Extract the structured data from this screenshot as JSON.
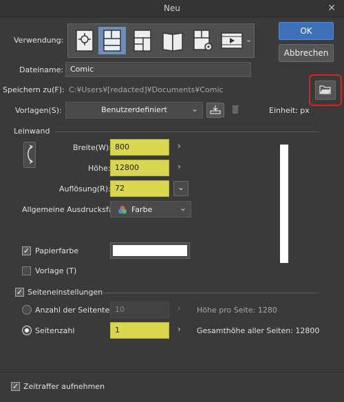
{
  "window": {
    "title": "Neu",
    "close": "✕"
  },
  "buttons": {
    "ok": "OK",
    "cancel": "Abbrechen"
  },
  "usage": {
    "label": "Verwendung:",
    "items": [
      "illustration-icon",
      "comic-icon",
      "layout-icon",
      "book-icon",
      "settings-page-icon",
      "animation-icon"
    ],
    "selected_index": 1
  },
  "filename": {
    "label": "Dateiname:",
    "value": "Comic"
  },
  "save_to": {
    "label": "Speichern zu(F):",
    "path": "C:¥Users¥[redacted]¥Documents¥Comic"
  },
  "templates": {
    "label": "Vorlagen(S):",
    "value": "Benutzerdefiniert",
    "unit_label": "Einheit: px"
  },
  "canvas": {
    "section": "Leinwand",
    "width": {
      "label": "Breite(W):",
      "value": "800"
    },
    "height": {
      "label": "Höhe:",
      "value": "12800"
    },
    "resolution": {
      "label": "Auflösung(R):",
      "value": "72"
    },
    "print_color": {
      "label": "Allgemeine Ausdrucksfarbe:",
      "value": "Farbe"
    },
    "paper_color": {
      "label": "Papierfarbe",
      "checked": true
    },
    "template": {
      "label": "Vorlage (T)",
      "checked": false
    }
  },
  "page_settings": {
    "section": "Seiteneinstellungen",
    "checked": true,
    "divisions": {
      "label": "Anzahl der Seitenteile",
      "value": "10",
      "info": "Höhe pro Seite: 1280"
    },
    "page_count": {
      "label": "Seitenzahl",
      "value": "1",
      "info": "Gesamthöhe aller Seiten: 12800"
    }
  },
  "timelapse": {
    "label": "Zeitraffer aufnehmen",
    "checked": true
  },
  "colors": {
    "highlight": "#d9d64f",
    "accent": "#3e70b8",
    "annotation": "#e02020"
  }
}
